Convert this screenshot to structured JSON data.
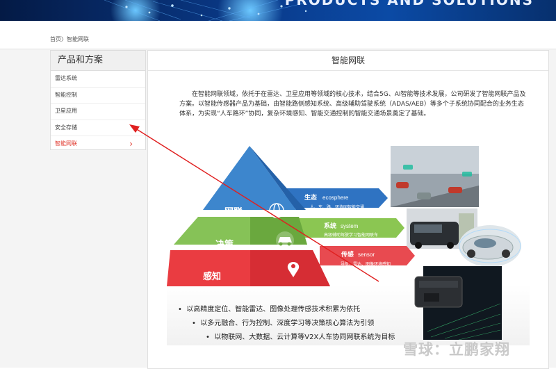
{
  "banner": {
    "text": "PRODUCTS AND SOLUTIONS"
  },
  "breadcrumb": {
    "home": "首页",
    "separator": "〉",
    "current": "智能网联"
  },
  "sidebar": {
    "title": "产品和方案",
    "items": [
      {
        "label": "雷达系统",
        "active": false
      },
      {
        "label": "智能控制",
        "active": false
      },
      {
        "label": "卫星应用",
        "active": false
      },
      {
        "label": "安全存储",
        "active": false
      },
      {
        "label": "智能网联",
        "active": true
      }
    ],
    "chevron_icon": "chevron-right-icon"
  },
  "main": {
    "title": "智能网联",
    "intro": "在智能网联领域，依托于在雷达、卫星应用等领域的核心技术，结合5G、AI智能等技术发展，公司研发了智能网联产品及方案。以智能传感器产品为基础，由智能路侧感知系统、高级辅助驾驶系统（ADAS/AEB）等多个子系统协同配合的业务生态体系，为实现“人车路环”协同，复杂环境感知、智能交通控制的智能交通场景奠定了基础。"
  },
  "pyramid": {
    "levels": [
      {
        "label": "网联",
        "tag_title": "生态",
        "tag_en": "ecosphere",
        "tag_desc": "人、车、路、环协同智能交通",
        "color": "#2e6fc0",
        "icon": "network-globe-icon"
      },
      {
        "label": "决策",
        "tag_title": "系统",
        "tag_en": "system",
        "tag_desc": "高级辅助驾驶学习智能网联车",
        "color": "#82c44a",
        "icon": "car-icon"
      },
      {
        "label": "感知",
        "tag_title": "传感",
        "tag_en": "sensor",
        "tag_desc": "导航、雷达、图像环境感知",
        "color": "#e8444a",
        "icon": "location-pin-icon"
      }
    ]
  },
  "bullets": [
    "以高精度定位、智能雷达、图像处理传感技术积累为依托",
    "以多元融合、行为控制、深度学习等决策核心算法为引领",
    "以物联网、大数据、云计算等V2X人车协同网联系统为目标"
  ],
  "watermark": {
    "text": "雪球：立鹏家翔"
  },
  "colors": {
    "accent_red": "#e03a2f",
    "banner_blue": "#0a3a8a",
    "arrow_red": "#e02020"
  }
}
